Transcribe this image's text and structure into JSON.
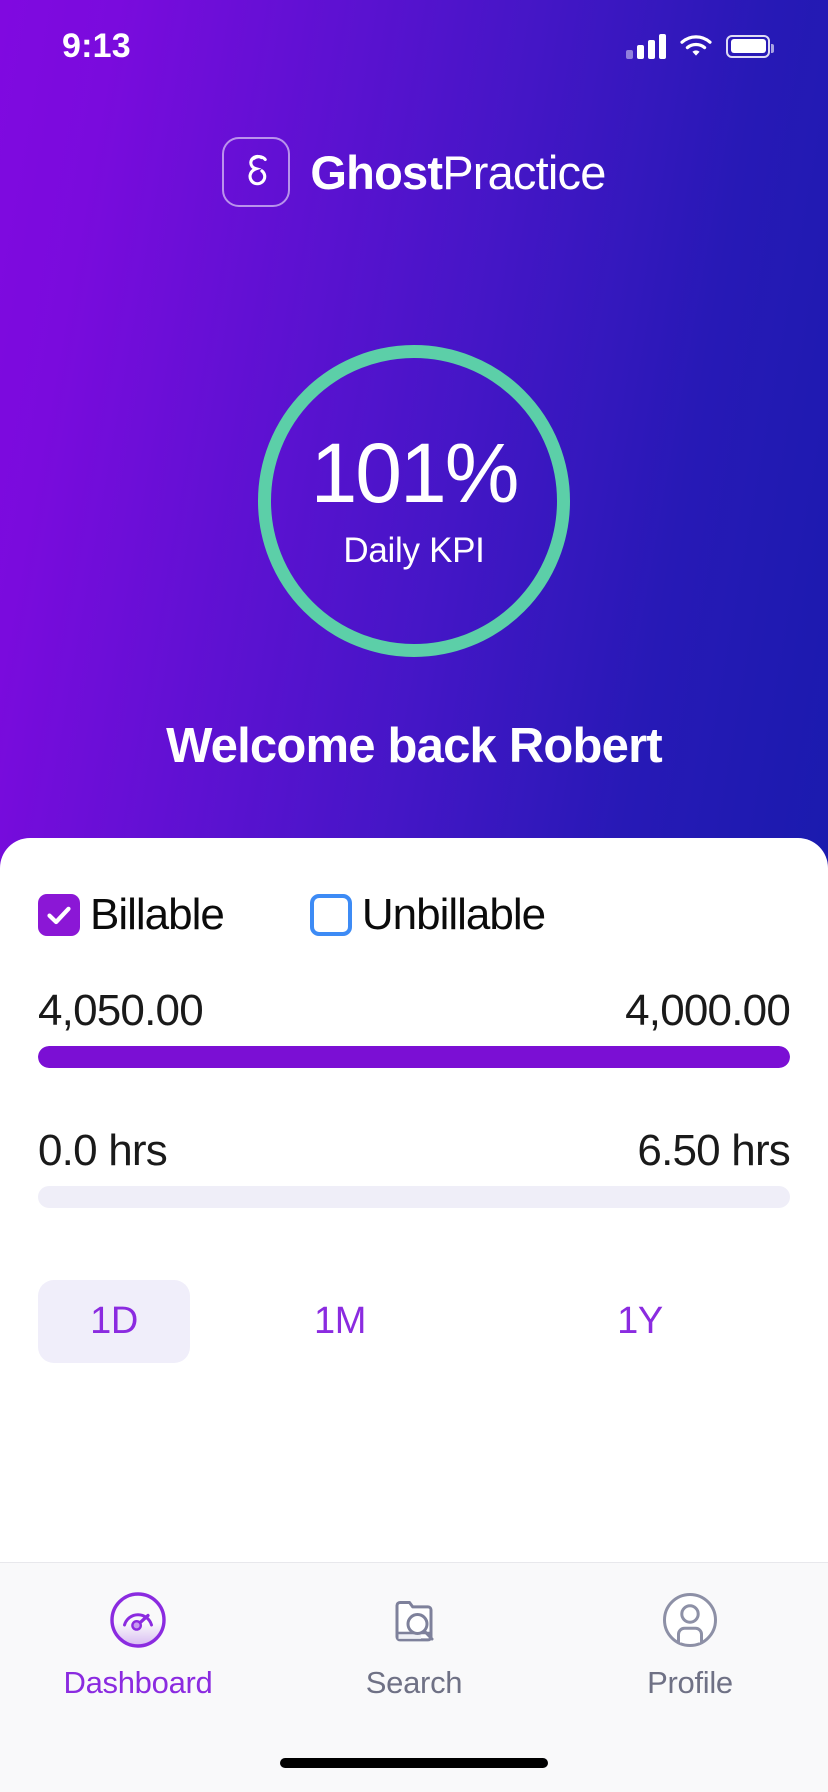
{
  "status_bar": {
    "time": "9:13",
    "signal_icon": "cellular-signal-icon",
    "wifi_icon": "wifi-icon",
    "battery_icon": "battery-full-icon"
  },
  "brand": {
    "logo_icon": "ghost-g-logo-icon",
    "name_bold": "Ghost",
    "name_light": "Practice"
  },
  "kpi": {
    "value": "101%",
    "label": "Daily KPI",
    "ring_color": "#5CCFA8",
    "percent": 101
  },
  "welcome": {
    "text": "Welcome back Robert"
  },
  "filters": [
    {
      "label": "Billable",
      "checked": true,
      "color": "#8B17D6"
    },
    {
      "label": "Unbillable",
      "checked": false,
      "color": "#3D8BF5"
    }
  ],
  "metrics": [
    {
      "name": "amount",
      "left_value": "4,050.00",
      "right_value": "4,000.00",
      "fill_percent": 100,
      "fill_color": "#7B0FD4",
      "track_color": "#EFEEF8"
    },
    {
      "name": "hours",
      "left_value": "0.0 hrs",
      "right_value": "6.50 hrs",
      "fill_percent": 0,
      "fill_color": "#7B0FD4",
      "track_color": "#EFEEF8"
    }
  ],
  "periods": [
    {
      "label": "1D",
      "active": true
    },
    {
      "label": "1M",
      "active": false
    },
    {
      "label": "1Y",
      "active": false
    }
  ],
  "tabs": [
    {
      "label": "Dashboard",
      "icon": "gauge-icon",
      "active": true
    },
    {
      "label": "Search",
      "icon": "folder-search-icon",
      "active": false
    },
    {
      "label": "Profile",
      "icon": "person-circle-icon",
      "active": false
    }
  ],
  "colors": {
    "gradient_start": "#8009E0",
    "gradient_end": "#1A1BAE",
    "accent_purple": "#8B2BE0",
    "accent_mint": "#5CCFA8",
    "accent_blue": "#3D8BF5"
  }
}
